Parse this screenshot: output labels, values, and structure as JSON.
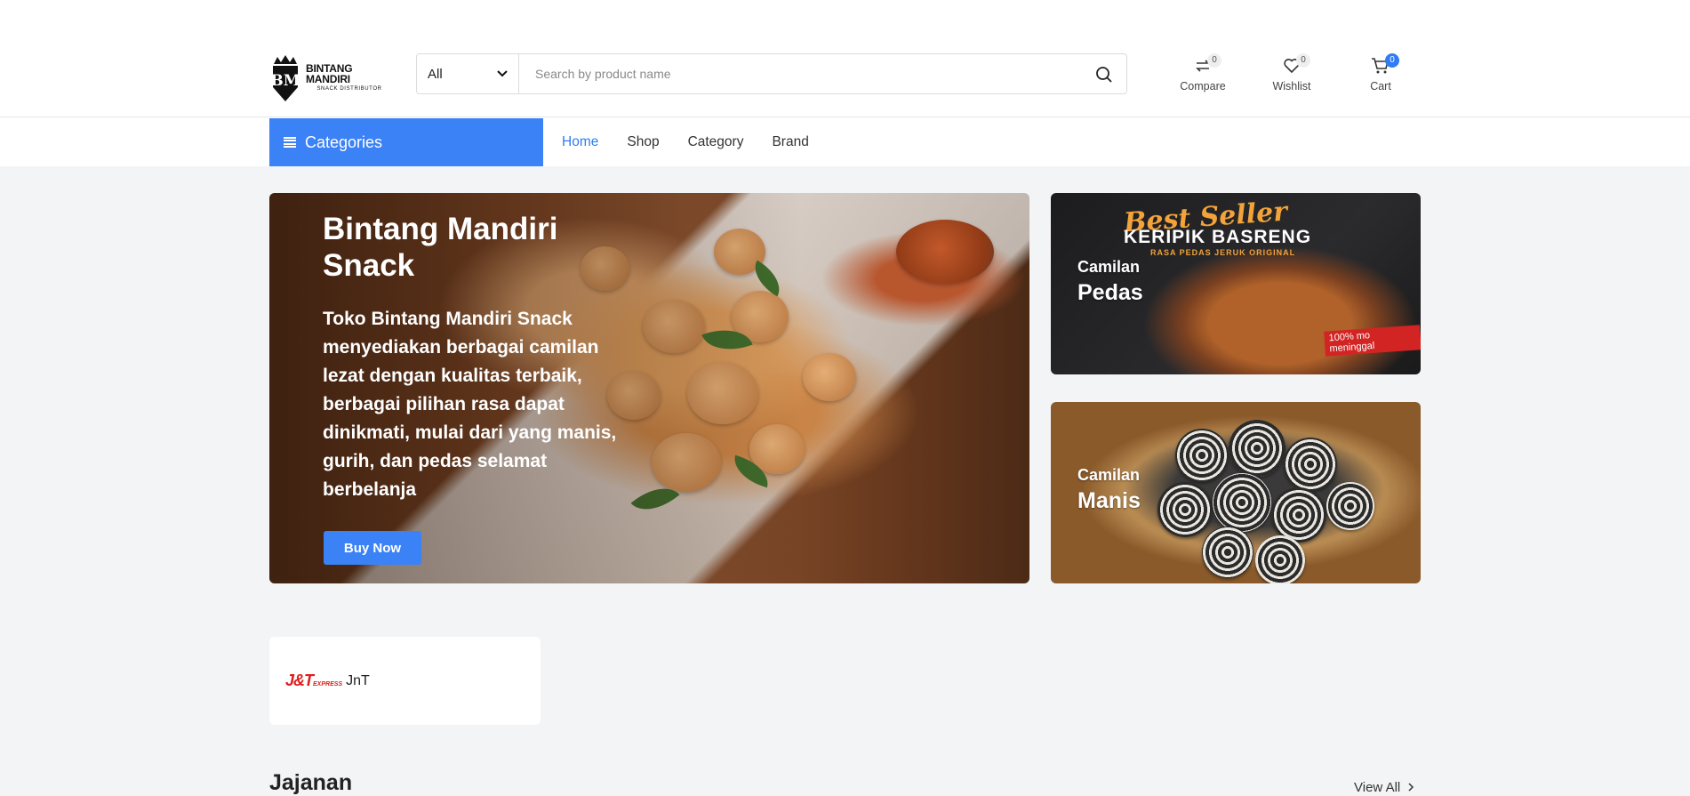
{
  "header": {
    "logo": {
      "title": "BINTANG MANDIRI",
      "subtitle": "SNACK DISTRIBUTOR",
      "monogram": "BM"
    },
    "search": {
      "category_selected": "All",
      "placeholder": "Search by product name",
      "icon": "search-icon"
    },
    "actions": [
      {
        "label": "Compare",
        "count": "0",
        "icon": "compare-icon"
      },
      {
        "label": "Wishlist",
        "count": "0",
        "icon": "heart-icon"
      },
      {
        "label": "Cart",
        "count": "0",
        "icon": "cart-icon"
      }
    ]
  },
  "nav": {
    "categories_label": "Categories",
    "links": [
      {
        "label": "Home",
        "active": true
      },
      {
        "label": "Shop",
        "active": false
      },
      {
        "label": "Category",
        "active": false
      },
      {
        "label": "Brand",
        "active": false
      }
    ]
  },
  "hero": {
    "title": "Bintang Mandiri Snack",
    "description": "Toko Bintang Mandiri Snack menyediakan berbagai camilan lezat dengan kualitas terbaik, berbagai pilihan rasa dapat dinikmati, mulai dari yang manis, gurih, dan pedas selamat berbelanja",
    "button": "Buy Now"
  },
  "banners": [
    {
      "small": "Camilan",
      "big": "Pedas",
      "art_title": "Best Seller",
      "art_subtitle": "KERIPIK BASRENG",
      "art_strip": "RASA PEDAS JERUK ORIGINAL",
      "art_tag": "100% mo meninggal"
    },
    {
      "small": "Camilan",
      "big": "Manis"
    }
  ],
  "couriers": [
    {
      "logo_text": "J&T",
      "logo_small": "EXPRESS",
      "name": "JnT"
    }
  ],
  "section": {
    "title": "Jajanan",
    "view_all": "View All"
  },
  "colors": {
    "accent": "#3b82f6",
    "badge": "#2f7cf6"
  }
}
